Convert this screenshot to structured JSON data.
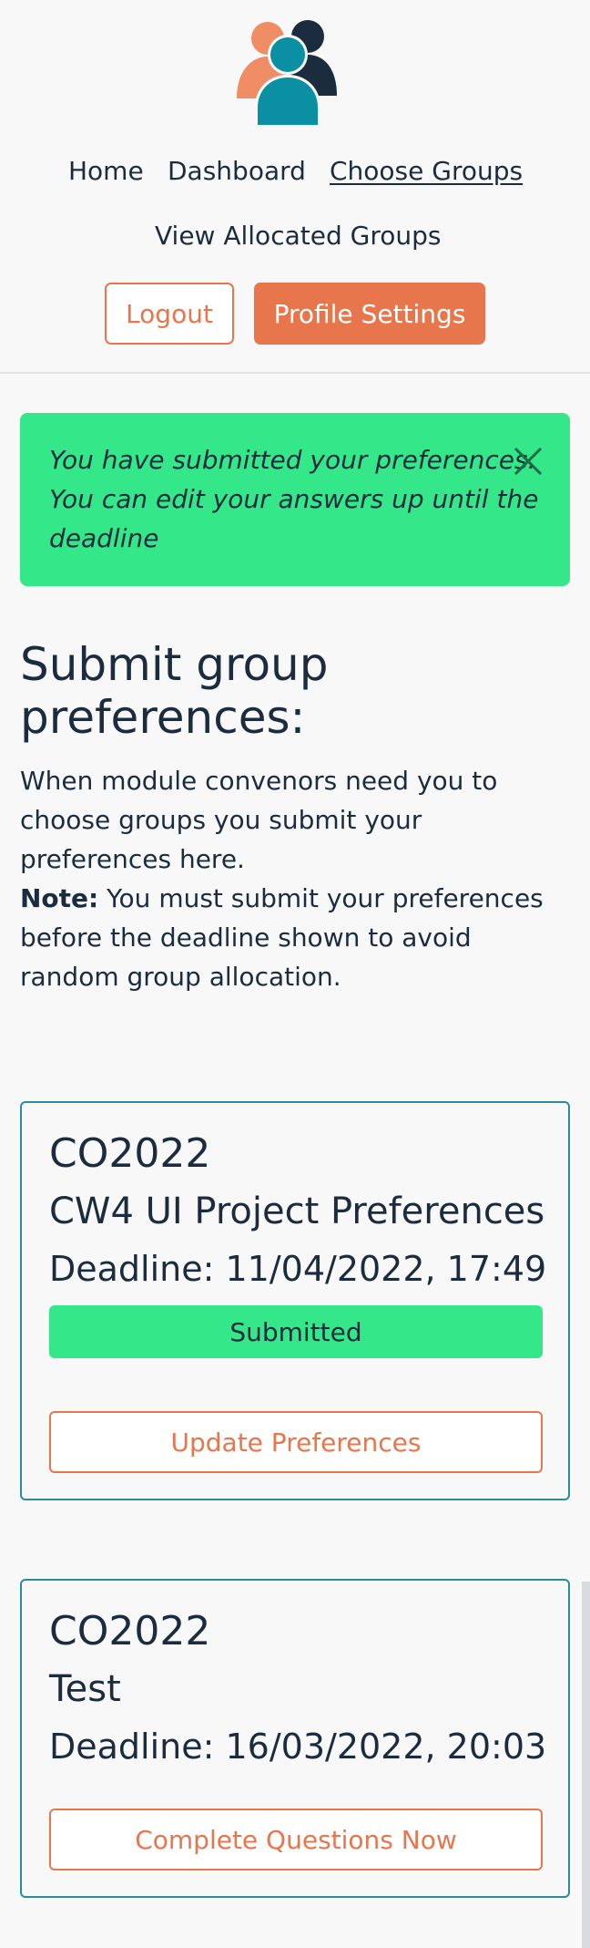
{
  "nav": {
    "home": "Home",
    "dashboard": "Dashboard",
    "choose_groups": "Choose Groups",
    "view_allocated": "View Allocated Groups",
    "logout": "Logout",
    "profile_settings": "Profile Settings"
  },
  "logo": {
    "icon": "people-group-icon"
  },
  "colors": {
    "accent": "#e7764d",
    "success": "#34e889",
    "card_border": "#2a8c99",
    "text": "#1c2c3f"
  },
  "alert": {
    "message": "You have submitted your preferences. You can edit your answers up until the deadline",
    "close_icon": "close-icon"
  },
  "main": {
    "heading": "Submit group preferences:",
    "intro": "When module convenors need you to choose groups you submit your preferences here.",
    "note_label": "Note:",
    "note_text": " You must submit your preferences before the deadline shown to avoid random group allocation."
  },
  "cards": [
    {
      "code": "CO2022",
      "title": "CW4 UI Project Preferences",
      "deadline": "Deadline: 11/04/2022, 17:49",
      "status": "Submitted",
      "action": "Update Preferences"
    },
    {
      "code": "CO2022",
      "title": "Test",
      "deadline": "Deadline: 16/03/2022, 20:03",
      "action": "Complete Questions Now"
    }
  ]
}
